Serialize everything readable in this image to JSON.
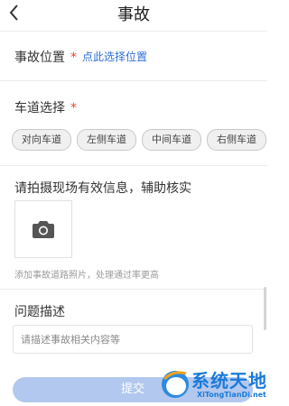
{
  "header": {
    "title": "事故"
  },
  "location": {
    "label": "事故位置",
    "required_mark": "*",
    "link": "点此选择位置"
  },
  "lane": {
    "label": "车道选择",
    "required_mark": "*",
    "options": [
      "对向车道",
      "左侧车道",
      "中间车道",
      "右侧车道"
    ]
  },
  "photo": {
    "label": "请拍摄现场有效信息，辅助核实",
    "hint": "添加事故道路照片，处理通过率更高"
  },
  "description": {
    "label": "问题描述",
    "placeholder": "请描述事故相关内容等"
  },
  "submit": {
    "label": "提交"
  },
  "watermark": {
    "title": "系统天地",
    "url": "XiTongTianDi.net"
  },
  "colors": {
    "accent_link": "#2e6fd6",
    "required": "#e8452f",
    "submit_bg": "#b2c8ee",
    "watermark": "#1a7ad8"
  }
}
